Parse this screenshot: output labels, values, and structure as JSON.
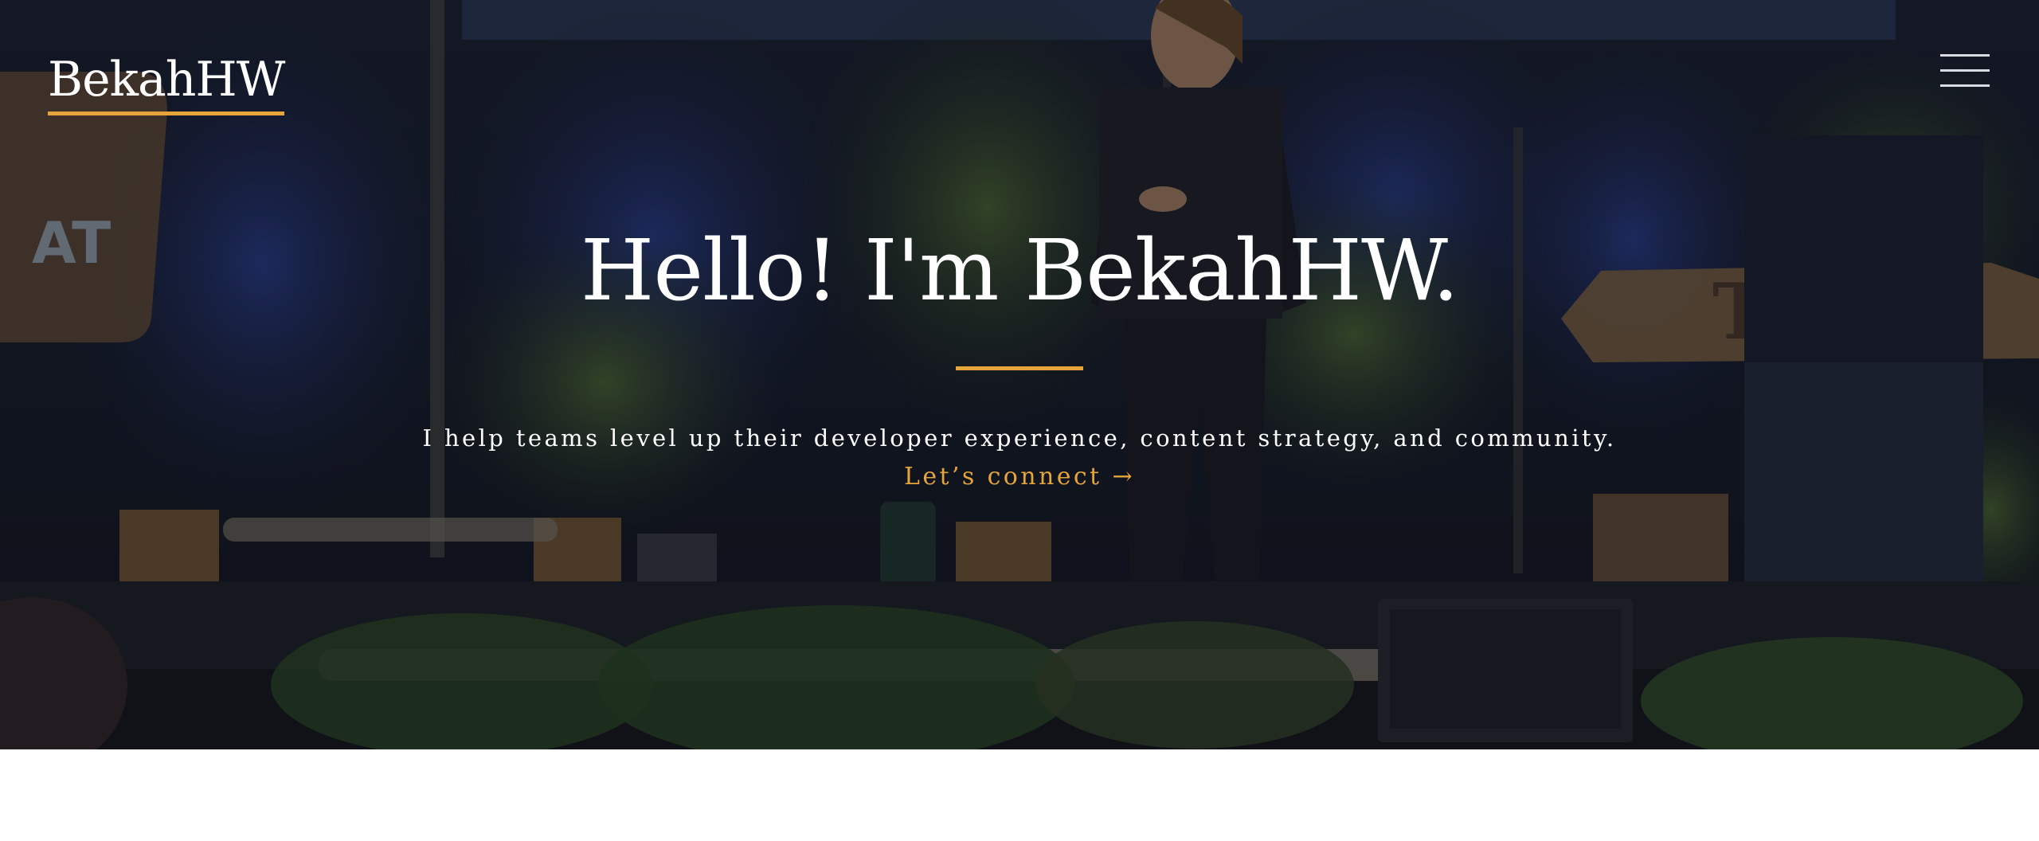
{
  "header": {
    "brand": "BekahHW",
    "menu_icon": "hamburger-menu-icon"
  },
  "hero": {
    "title": "Hello! I'm BekahHW.",
    "subtitle": "I help teams level up their developer experience, content strategy, and community.",
    "cta_label": "Let’s connect →",
    "background_image": "speaker-on-stage-photo"
  },
  "colors": {
    "accent": "#e5a53a",
    "text": "#ffffff",
    "page_background": "#ffffff"
  }
}
